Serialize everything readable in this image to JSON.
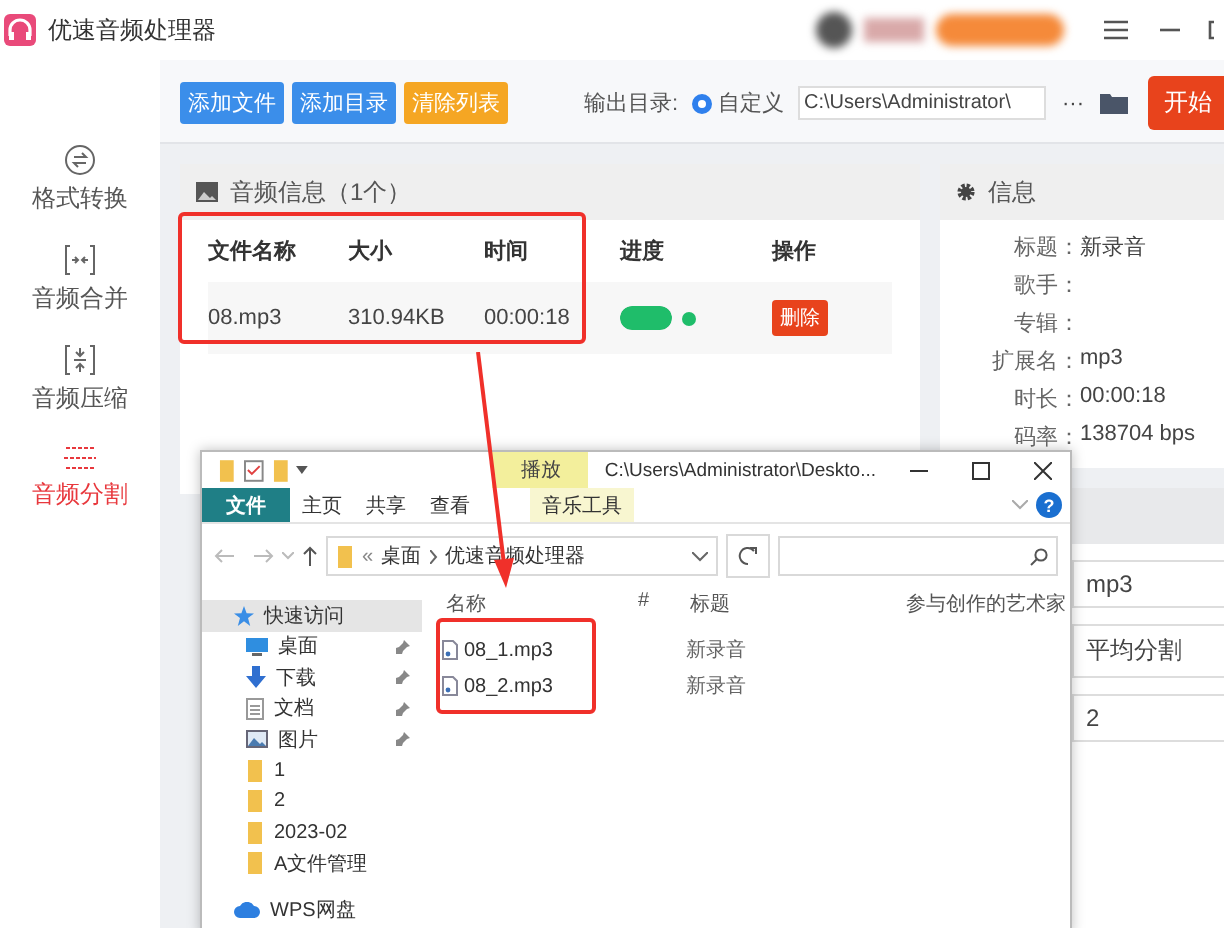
{
  "window": {
    "title": "优速音频处理器"
  },
  "sidebar": {
    "items": [
      {
        "label": "格式转换",
        "kind": "convert",
        "selected": false
      },
      {
        "label": "音频合并",
        "kind": "merge",
        "selected": false
      },
      {
        "label": "音频压缩",
        "kind": "compress",
        "selected": false
      },
      {
        "label": "音频分割",
        "kind": "split",
        "selected": true
      }
    ]
  },
  "toolbar": {
    "buttons": [
      {
        "label": "添加文件",
        "kind": "primary"
      },
      {
        "label": "添加目录",
        "kind": "primary"
      },
      {
        "label": "清除列表",
        "kind": "warning"
      }
    ],
    "output_label": "输出目录:",
    "radio": {
      "label": "自定义",
      "selected": true
    },
    "path_field": {
      "value": "C:\\Users\\Administrator\\"
    },
    "more_button": "···",
    "start_button": "开始"
  },
  "audio_panel": {
    "title": "音频信息（1个）",
    "columns": [
      "文件名称",
      "大小",
      "时间",
      "进度",
      "操作"
    ],
    "rows": [
      {
        "name": "08.mp3",
        "size": "310.94KB",
        "time": "00:00:18",
        "level": 1,
        "action": "删除"
      }
    ]
  },
  "info_panel": {
    "title": "信息",
    "fields": [
      {
        "label": "标题：",
        "value": "新录音"
      },
      {
        "label": "歌手："
      },
      {
        "label": "专辑："
      },
      {
        "label": "扩展名：",
        "value": "mp3"
      },
      {
        "label": "时长：",
        "value": "00:00:18"
      },
      {
        "label": "码率：",
        "value": "138704 bps"
      }
    ]
  },
  "split_settings": {
    "selects": [
      {
        "value": "mp3"
      },
      {
        "value": "平均分割"
      },
      {
        "value": "2"
      }
    ]
  },
  "explorer": {
    "title": "C:\\Users\\Administrator\\Deskto...",
    "context_tab": "播放",
    "help_glyph": "?",
    "ribbon_tabs": [
      {
        "label": "文件",
        "kind": "file",
        "selected": true
      },
      {
        "label": "主页",
        "kind": "plain",
        "selected": false
      },
      {
        "label": "共享",
        "kind": "plain",
        "selected": false
      },
      {
        "label": "查看",
        "kind": "plain",
        "selected": false
      },
      {
        "label": "音乐工具",
        "kind": "context",
        "selected": false
      }
    ],
    "overflow_glyph": "«",
    "breadcrumb": [
      "桌面",
      "优速音频处理器"
    ],
    "columns": [
      "名称",
      "#",
      "标题",
      "参与创作的艺术家"
    ],
    "nav": [
      {
        "label": "快速访问",
        "kind": "star",
        "selected": true,
        "pinned": false
      },
      {
        "label": "桌面",
        "kind": "desktop",
        "selected": false,
        "pinned": true
      },
      {
        "label": "下载",
        "kind": "download",
        "selected": false,
        "pinned": true
      },
      {
        "label": "文档",
        "kind": "document",
        "selected": false,
        "pinned": true
      },
      {
        "label": "图片",
        "kind": "picture",
        "selected": false,
        "pinned": true
      },
      {
        "label": "1",
        "kind": "folder",
        "selected": false,
        "pinned": false
      },
      {
        "label": "2",
        "kind": "folder",
        "selected": false,
        "pinned": false
      },
      {
        "label": "2023-02",
        "kind": "folder",
        "selected": false,
        "pinned": false
      },
      {
        "label": "A文件管理",
        "kind": "folder",
        "selected": false,
        "pinned": false
      },
      {
        "label": "WPS网盘",
        "kind": "cloud",
        "selected": false,
        "pinned": false
      }
    ],
    "files": [
      {
        "name": "08_1.mp3",
        "title": "新录音"
      },
      {
        "name": "08_2.mp3",
        "title": "新录音"
      }
    ]
  }
}
